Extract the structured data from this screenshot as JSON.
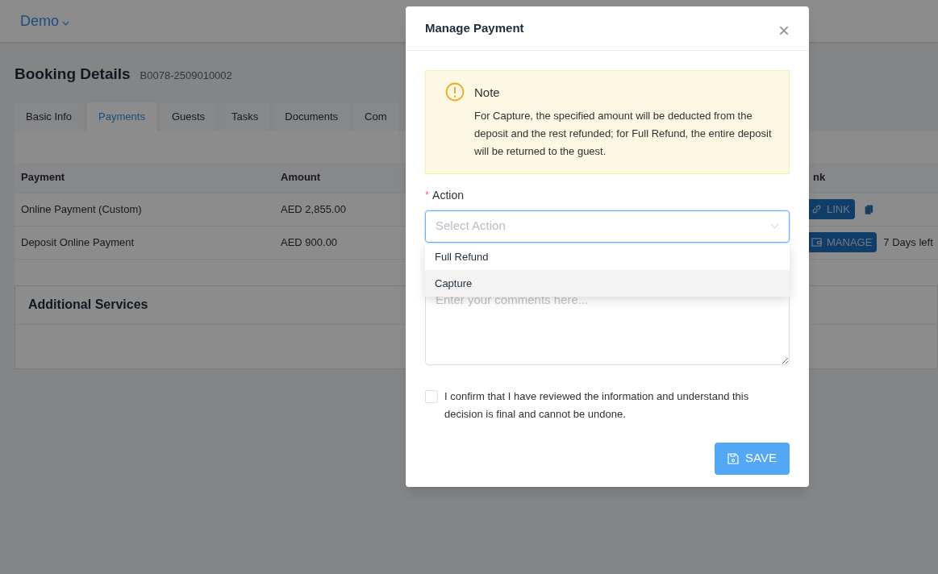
{
  "header": {
    "workspace": "Demo"
  },
  "page": {
    "title": "Booking Details",
    "booking_id": "B0078-2509010002"
  },
  "tabs": [
    {
      "label": "Basic Info",
      "selected": false
    },
    {
      "label": "Payments",
      "selected": true
    },
    {
      "label": "Guests",
      "selected": false
    },
    {
      "label": "Tasks",
      "selected": false
    },
    {
      "label": "Documents",
      "selected": false
    },
    {
      "label": "Com",
      "selected": false
    }
  ],
  "table": {
    "columns": [
      "Payment",
      "Amount",
      "nk"
    ],
    "rows": [
      {
        "payment": "Online Payment (Custom)",
        "amount": "AED 2,855.00",
        "action": {
          "kind": "link",
          "label": "LINK"
        }
      },
      {
        "payment": "Deposit Online Payment",
        "amount": "AED 900.00",
        "action": {
          "kind": "manage",
          "label": "MANAGE"
        },
        "note": "7 Days left"
      }
    ]
  },
  "additional_services": {
    "title": "Additional Services"
  },
  "modal": {
    "title": "Manage Payment",
    "close": "×",
    "note": {
      "title": "Note",
      "text": "For Capture, the specified amount will be deducted from the deposit and the rest refunded; for Full Refund, the entire deposit will be returned to the guest."
    },
    "action_field": {
      "label": "Action",
      "required_mark": "*",
      "placeholder": "Select Action",
      "expanded": true,
      "options": [
        {
          "label": "Full Refund",
          "selected": false
        },
        {
          "label": "Capture",
          "selected": true
        }
      ]
    },
    "comments": {
      "placeholder": "Enter your comments here..."
    },
    "confirm": {
      "label": "I confirm that I have reviewed the information and understand this decision is final and cannot be undone.",
      "checked": false
    },
    "save": "SAVE"
  }
}
